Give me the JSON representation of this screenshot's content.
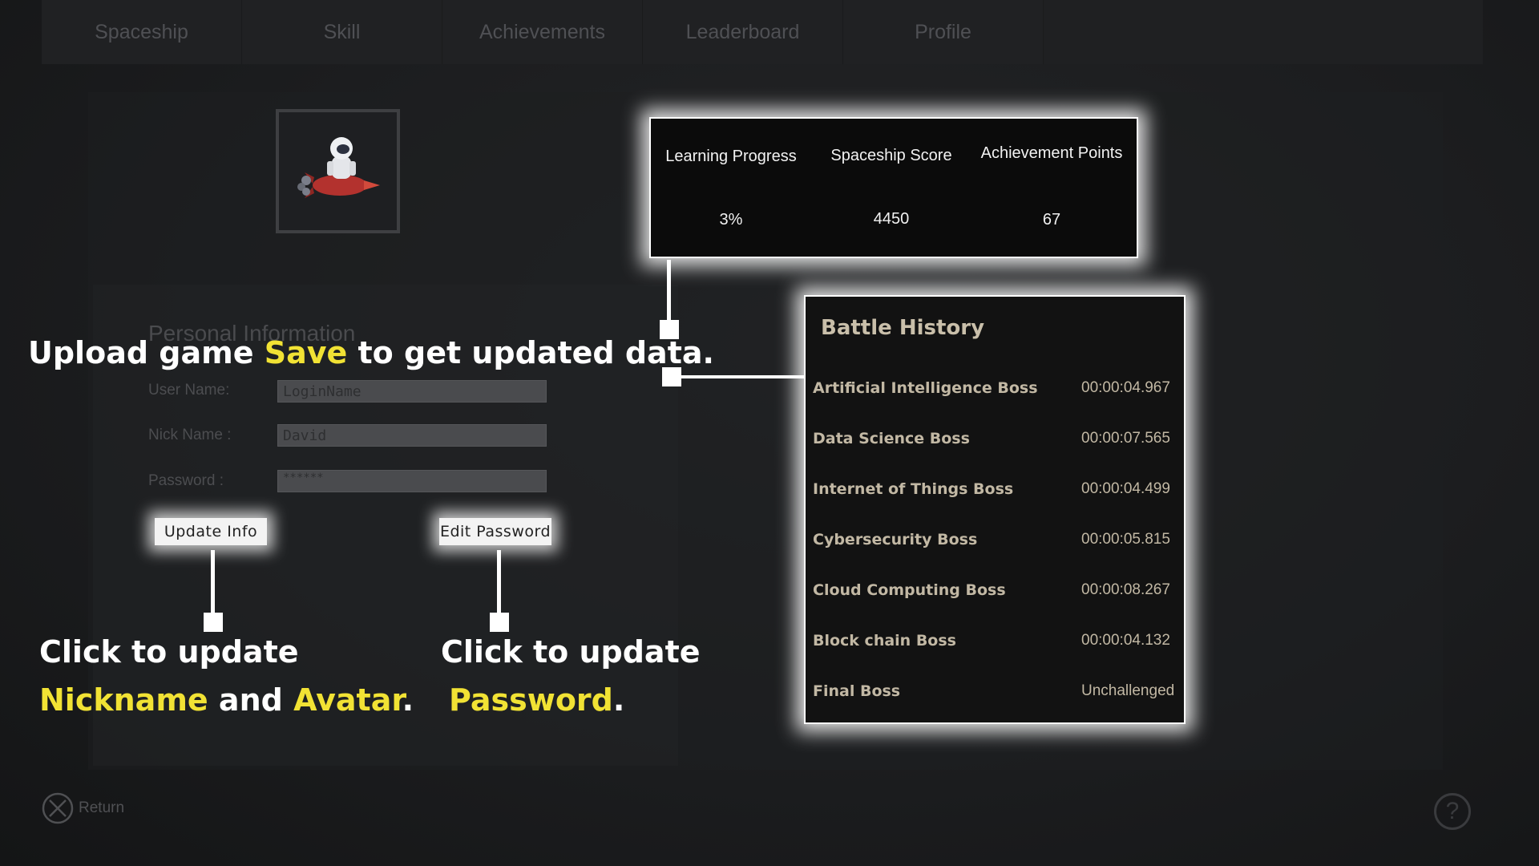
{
  "nav": {
    "tabs": [
      {
        "label": "Spaceship"
      },
      {
        "label": "Skill"
      },
      {
        "label": "Achievements"
      },
      {
        "label": "Leaderboard"
      },
      {
        "label": "Profile"
      }
    ]
  },
  "personal_info": {
    "title": "Personal Information",
    "username_label": "User Name:",
    "username_value": "LoginName",
    "nickname_label": "Nick Name :",
    "nickname_value": "David",
    "password_label": "Password :",
    "password_value": "******",
    "update_button": "Update Info",
    "edit_password_button": "Edit Password"
  },
  "stats": {
    "learning_progress_label": "Learning Progress",
    "learning_progress_value": "3%",
    "spaceship_score_label": "Spaceship Score",
    "spaceship_score_value": "4450",
    "achievement_points_label": "Achievement Points",
    "achievement_points_value": "67"
  },
  "battle_history": {
    "title": "Battle History",
    "rows": [
      {
        "boss": "Artificial Intelligence Boss",
        "time": "00:00:04.967"
      },
      {
        "boss": "Data Science Boss",
        "time": "00:00:07.565"
      },
      {
        "boss": "Internet of Things Boss",
        "time": "00:00:04.499"
      },
      {
        "boss": "Cybersecurity Boss",
        "time": "00:00:05.815"
      },
      {
        "boss": "Cloud Computing Boss",
        "time": "00:00:08.267"
      },
      {
        "boss": "Block chain Boss",
        "time": "00:00:04.132"
      },
      {
        "boss": "Final Boss",
        "time": "Unchallenged"
      }
    ]
  },
  "annotations": {
    "upload_pre": "Upload game ",
    "upload_hl": "Save",
    "upload_post": " to get updated data.",
    "update_line1": "Click to update",
    "update_hl1": "Nickname",
    "update_mid": " and ",
    "update_hl2": "Avatar",
    "update_end": ".",
    "password_line1": "Click to update",
    "password_hl": "Password",
    "password_end": "."
  },
  "footer": {
    "return_label": "Return",
    "help_symbol": "?"
  },
  "icons": {
    "avatar": "astronaut-rocket-icon",
    "return": "close-circle-icon",
    "help": "question-circle-icon"
  },
  "colors": {
    "highlight": "#f1e234",
    "background": "#1c1d1f"
  }
}
